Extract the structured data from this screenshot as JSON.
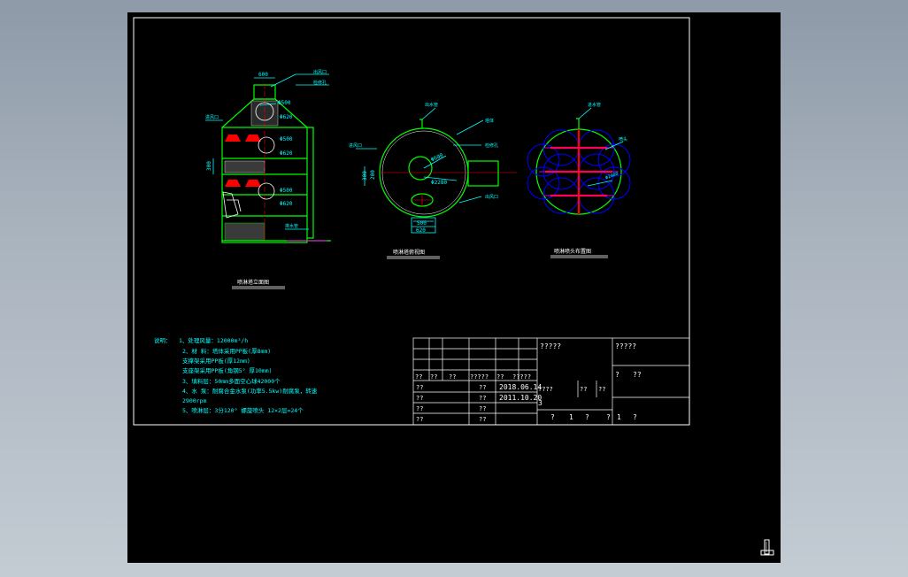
{
  "views": {
    "front": {
      "title": "喷淋塔立面图",
      "dims": {
        "top_width": "600",
        "d1": "Φ500",
        "d2": "Φ620",
        "d3": "Φ500",
        "d4": "Φ620",
        "d5": "Φ500",
        "d6": "Φ620",
        "height": "300"
      },
      "callouts": {
        "c1": "出风口",
        "c2": "检修孔",
        "c3": "进风口",
        "c4": "排水管"
      }
    },
    "plan": {
      "title": "喷淋塔俯视图",
      "dims": {
        "inner": "Φ600",
        "outer": "Φ2280",
        "w1": "500",
        "w2": "620",
        "side1": "300",
        "side2": "200"
      },
      "callouts": {
        "c1": "出水管",
        "c2": "塔体",
        "c3": "进风口",
        "c4": "检修孔",
        "c5": "出风口"
      }
    },
    "spray": {
      "title": "喷淋喷头布置图",
      "dims": {
        "d": "Φ2000"
      },
      "callouts": {
        "c1": "进水管",
        "c2": "喷头"
      }
    }
  },
  "notes": {
    "heading": "说明：",
    "lines": [
      "1、处理风量：12000m³/h",
      "2、材  料：塔体采用PP板(厚8mm)",
      "         支撑架采用PP板(厚12mm)",
      "         支座架采用PP板(角钢5° 厚10mm)",
      "3、填料层：50mm多面空心球42000个",
      "4、水  泵：耐腐合金水泵(功率5.5kw)耐腐泵，转速",
      "         2900rpm",
      "5、喷淋层：3分120° 螺旋喷头 12×2层=24个"
    ]
  },
  "title_block": {
    "company": "?????",
    "drawing_name": "?????",
    "scale_row": [
      "?",
      "??"
    ],
    "sheet_row": [
      "?",
      "1",
      "?",
      "?",
      "1",
      "?"
    ],
    "rev_labels": [
      "??",
      "??",
      "??",
      "?????",
      "??",
      "?????"
    ],
    "rows": [
      {
        "role": "??",
        "sign": "??",
        "date": "2018.06.14",
        "extra": "????",
        "m1": "??",
        "m2": "??"
      },
      {
        "role": "??",
        "sign": "??",
        "date": "2011.10.20",
        "extra": "3"
      },
      {
        "role": "??",
        "sign": "??"
      },
      {
        "role": "??",
        "sign": "??"
      }
    ]
  },
  "colors": {
    "frame": "#ffffff",
    "structure": "#00ff00",
    "dimension": "#00ffff",
    "spray": "#ff0000",
    "pipe": "#0000ff",
    "magenta": "#ff00ff"
  }
}
